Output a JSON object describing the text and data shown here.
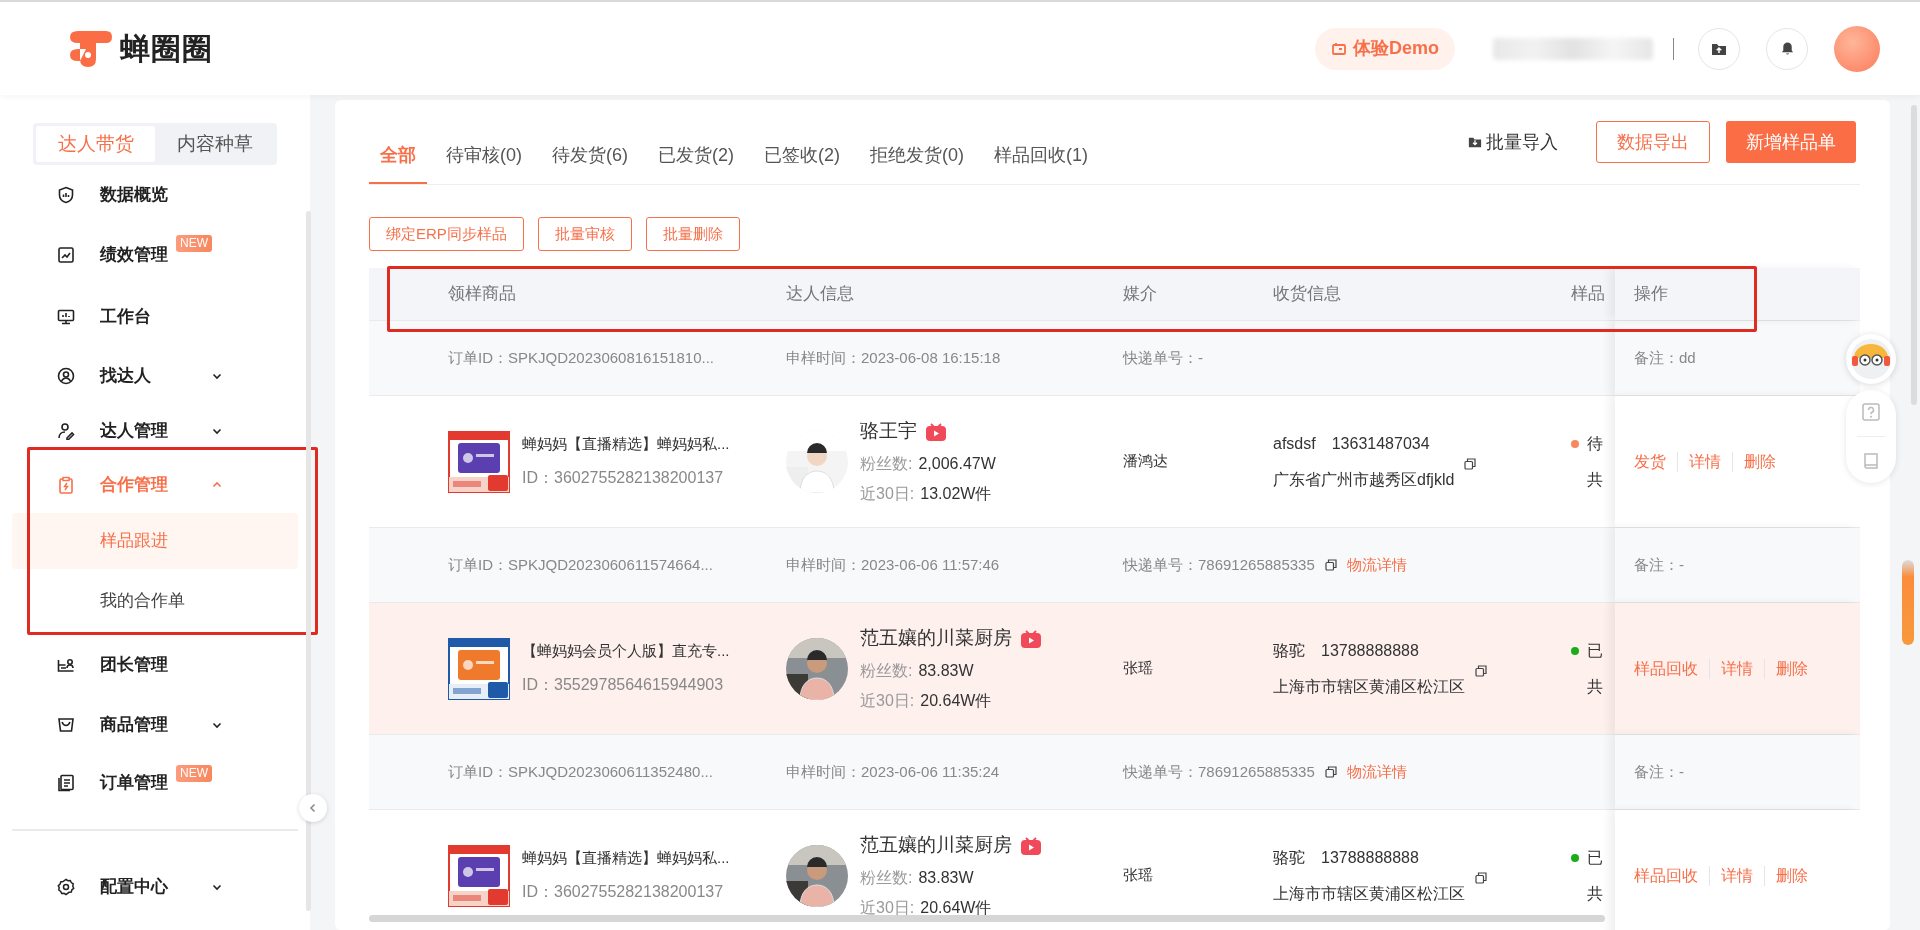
{
  "header": {
    "logo_text": "蝉圈圈",
    "demo_button": "体验Demo"
  },
  "sidebar": {
    "segments": [
      {
        "label": "达人带货",
        "selected": true
      },
      {
        "label": "内容种草",
        "selected": false
      }
    ],
    "items": [
      {
        "label": "数据概览",
        "selected": false
      },
      {
        "label": "绩效管理",
        "badge": "NEW",
        "selected": false
      },
      {
        "label": "工作台",
        "selected": false
      },
      {
        "label": "找达人",
        "expanded": false,
        "selected": false
      },
      {
        "label": "达人管理",
        "expanded": false,
        "selected": false
      },
      {
        "label": "合作管理",
        "expanded": true,
        "selected": true,
        "highlighted": true,
        "children": [
          {
            "label": "样品跟进",
            "selected": true
          },
          {
            "label": "我的合作单",
            "selected": false
          }
        ]
      },
      {
        "label": "团长管理",
        "selected": false
      },
      {
        "label": "商品管理",
        "expanded": false,
        "selected": false
      },
      {
        "label": "订单管理",
        "badge": "NEW",
        "selected": false
      }
    ],
    "footer_items": [
      {
        "label": "配置中心",
        "expanded": false,
        "selected": false
      }
    ]
  },
  "tabs": [
    {
      "label": "全部",
      "selected": true
    },
    {
      "label": "待审核(0)",
      "selected": false
    },
    {
      "label": "待发货(6)",
      "selected": false
    },
    {
      "label": "已发货(2)",
      "selected": false
    },
    {
      "label": "已签收(2)",
      "selected": false
    },
    {
      "label": "拒绝发货(0)",
      "selected": false
    },
    {
      "label": "样品回收(1)",
      "selected": false
    }
  ],
  "toolbar": [
    {
      "label": "批量导入",
      "kind": "link"
    },
    {
      "label": "数据导出",
      "kind": "outline"
    },
    {
      "label": "新增样品单",
      "kind": "primary"
    }
  ],
  "bulk_actions": [
    "绑定ERP同步样品",
    "批量审核",
    "批量删除"
  ],
  "table": {
    "header_highlighted": true,
    "columns": [
      "领样商品",
      "达人信息",
      "媒介",
      "收货信息",
      "样品",
      "操作"
    ],
    "rows": [
      {
        "order_id": "订单ID：SPKJQD2023060816151810...",
        "apply_time": "申样时间：2023-06-08 16:15:18",
        "tracking": "快递单号：-",
        "note": "备注：dd",
        "product_title": "蝉妈妈【直播精选】蝉妈妈私...",
        "product_id": "ID：3602755282138200137",
        "creator_name": "骆王宇",
        "followers_label": "粉丝数:",
        "followers": "2,006.47W",
        "sales_label": "近30日:",
        "sales": "13.02W件",
        "agent": "潘鸿达",
        "receiver": "afsdsf",
        "phone": "13631487034",
        "address": "广东省广州市越秀区dfjkld",
        "status": "待",
        "color": "#f7875e",
        "total": "共",
        "actions": [
          "发货",
          "详情",
          "删除"
        ],
        "highlighted": false
      },
      {
        "order_id": "订单ID：SPKJQD2023060611574664...",
        "apply_time": "申样时间：2023-06-06 11:57:46",
        "tracking": "快递单号：78691265885335",
        "logistics_link": "物流详情",
        "note": "备注：-",
        "product_title": "【蝉妈妈会员个人版】直充专...",
        "product_id": "ID：3552978564615944903",
        "creator_name": "范五孃的川菜厨房",
        "followers_label": "粉丝数:",
        "followers": "83.83W",
        "sales_label": "近30日:",
        "sales": "20.64W件",
        "agent": "张瑶",
        "receiver": "骆驼",
        "phone": "13788888888",
        "address": "上海市市辖区黄浦区松江区",
        "status": "已",
        "color": "#1aad19",
        "total": "共",
        "actions": [
          "样品回收",
          "详情",
          "删除"
        ],
        "highlighted": true
      },
      {
        "order_id": "订单ID：SPKJQD2023060611352480...",
        "apply_time": "申样时间：2023-06-06 11:35:24",
        "tracking": "快递单号：78691265885335",
        "logistics_link": "物流详情",
        "note": "备注：-",
        "product_title": "蝉妈妈【直播精选】蝉妈妈私...",
        "product_id": "ID：3602755282138200137",
        "creator_name": "范五孃的川菜厨房",
        "followers_label": "粉丝数:",
        "followers": "83.83W",
        "sales_label": "近30日:",
        "sales": "20.64W件",
        "agent": "张瑶",
        "receiver": "骆驼",
        "phone": "13788888888",
        "address": "上海市市辖区黄浦区松江区",
        "status": "已",
        "color": "#1aad19",
        "total": "共",
        "actions": [
          "样品回收",
          "详情",
          "删除"
        ],
        "highlighted": false
      }
    ]
  }
}
